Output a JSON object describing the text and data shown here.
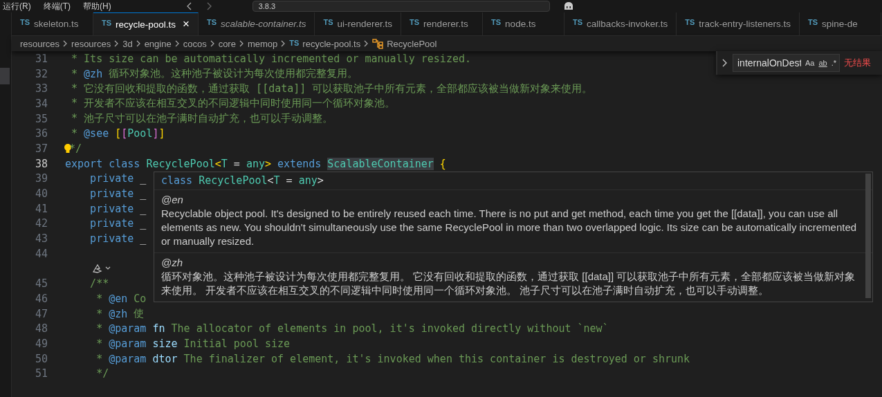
{
  "menu": [
    "运行(R)",
    "终端(T)",
    "帮助(H)"
  ],
  "command_center": {
    "value": "3.8.3"
  },
  "tabs": [
    {
      "lang": "TS",
      "label": "skeleton.ts",
      "selected": false,
      "preview": false
    },
    {
      "lang": "TS",
      "label": "recycle-pool.ts",
      "selected": true,
      "preview": false,
      "close": "×"
    },
    {
      "lang": "TS",
      "label": "scalable-container.ts",
      "selected": false,
      "preview": true
    },
    {
      "lang": "TS",
      "label": "ui-renderer.ts",
      "selected": false,
      "preview": false
    },
    {
      "lang": "TS",
      "label": "renderer.ts",
      "selected": false,
      "preview": false
    },
    {
      "lang": "TS",
      "label": "node.ts",
      "selected": false,
      "preview": false
    },
    {
      "lang": "TS",
      "label": "callbacks-invoker.ts",
      "selected": false,
      "preview": false
    },
    {
      "lang": "TS",
      "label": "track-entry-listeners.ts",
      "selected": false,
      "preview": false
    },
    {
      "lang": "TS",
      "label": "spine-de",
      "selected": false,
      "preview": false
    }
  ],
  "breadcrumb": [
    {
      "kind": "folder",
      "label": "resources"
    },
    {
      "kind": "folder",
      "label": "resources"
    },
    {
      "kind": "folder",
      "label": "3d"
    },
    {
      "kind": "folder",
      "label": "engine"
    },
    {
      "kind": "folder",
      "label": "cocos"
    },
    {
      "kind": "folder",
      "label": "core"
    },
    {
      "kind": "folder",
      "label": "memop"
    },
    {
      "kind": "file",
      "lang": "TS",
      "label": "recycle-pool.ts"
    },
    {
      "kind": "class",
      "label": "RecyclePool"
    }
  ],
  "find_widget": {
    "value": "internalOnDest",
    "options": [
      "Aa",
      "ab",
      ".*"
    ],
    "result": "无结果"
  },
  "lines": [
    {
      "number": "31",
      "current": false,
      "tokens": [
        {
          "kind": "comment",
          "s": " * Its size can be automatically incremented or manually resized."
        }
      ]
    },
    {
      "number": "32",
      "current": false,
      "tokens": [
        {
          "kind": "comment",
          "s": " * "
        },
        {
          "kind": "tag",
          "s": "@zh"
        },
        {
          "kind": "comment",
          "s": " 循环对象池。这种池子被设计为每次使用都完整复用。"
        }
      ]
    },
    {
      "number": "33",
      "current": false,
      "tokens": [
        {
          "kind": "comment",
          "s": " * 它没有回收和提取的函数，通过获取 [[data]] 可以获取池子中所有元素，全部都应该被当做新对象来使用。"
        }
      ]
    },
    {
      "number": "34",
      "current": false,
      "tokens": [
        {
          "kind": "comment",
          "s": " * 开发者不应该在相互交叉的不同逻辑中同时使用同一个循环对象池。"
        }
      ]
    },
    {
      "number": "35",
      "current": false,
      "tokens": [
        {
          "kind": "comment",
          "s": " * 池子尺寸可以在池子满时自动扩充，也可以手动调整。"
        }
      ]
    },
    {
      "number": "36",
      "current": false,
      "tokens": [
        {
          "kind": "comment",
          "s": " * "
        },
        {
          "kind": "tag",
          "s": "@see "
        },
        {
          "kind": "bracket1",
          "s": "["
        },
        {
          "kind": "bracket2",
          "s": "["
        },
        {
          "kind": "type",
          "s": "Pool"
        },
        {
          "kind": "bracket2",
          "s": "]"
        },
        {
          "kind": "bracket1",
          "s": "]"
        }
      ]
    },
    {
      "number": "37",
      "current": false,
      "bulb": true,
      "tokens": [
        {
          "kind": "comment",
          "s": "*/"
        }
      ]
    },
    {
      "number": "38",
      "current": true,
      "tokens": [
        {
          "kind": "keyword",
          "s": "export class "
        },
        {
          "kind": "type",
          "s": "RecyclePool"
        },
        {
          "kind": "bracket1",
          "s": "<"
        },
        {
          "kind": "type",
          "s": "T"
        },
        {
          "kind": "plain",
          "s": " = "
        },
        {
          "kind": "type",
          "s": "any"
        },
        {
          "kind": "bracket1",
          "s": ">"
        },
        {
          "kind": "keyword",
          "s": " extends "
        },
        {
          "kind": "highlight",
          "s": "ScalableContainer"
        },
        {
          "kind": "bracket1",
          "s": " {"
        }
      ]
    },
    {
      "number": "39",
      "current": false,
      "tokens": [
        {
          "kind": "keyword",
          "s": "    private"
        },
        {
          "kind": "plain",
          "s": " _"
        }
      ]
    },
    {
      "number": "40",
      "current": false,
      "tokens": [
        {
          "kind": "keyword",
          "s": "    private"
        },
        {
          "kind": "plain",
          "s": " _"
        }
      ]
    },
    {
      "number": "41",
      "current": false,
      "tokens": [
        {
          "kind": "keyword",
          "s": "    private"
        },
        {
          "kind": "plain",
          "s": " _"
        }
      ]
    },
    {
      "number": "42",
      "current": false,
      "tokens": [
        {
          "kind": "keyword",
          "s": "    private"
        },
        {
          "kind": "plain",
          "s": " _"
        }
      ]
    },
    {
      "number": "43",
      "current": false,
      "tokens": [
        {
          "kind": "keyword",
          "s": "    private"
        },
        {
          "kind": "plain",
          "s": " _"
        }
      ]
    },
    {
      "number": "44",
      "current": false
    },
    {
      "kind": "codelens"
    },
    {
      "number": "45",
      "current": false,
      "tokens": [
        {
          "kind": "comment",
          "s": "    /**"
        }
      ]
    },
    {
      "number": "46",
      "current": false,
      "tokens": [
        {
          "kind": "comment",
          "s": "     * "
        },
        {
          "kind": "tag",
          "s": "@en"
        },
        {
          "kind": "comment",
          "s": " Co"
        }
      ]
    },
    {
      "number": "47",
      "current": false,
      "tokens": [
        {
          "kind": "comment",
          "s": "     * "
        },
        {
          "kind": "tag",
          "s": "@zh"
        },
        {
          "kind": "comment",
          "s": " 使"
        }
      ]
    },
    {
      "number": "48",
      "current": false,
      "tokens": [
        {
          "kind": "comment",
          "s": "     * "
        },
        {
          "kind": "tag",
          "s": "@param"
        },
        {
          "kind": "param",
          "s": " fn"
        },
        {
          "kind": "comment",
          "s": " The allocator of elements in pool, it's invoked directly without `new`"
        }
      ]
    },
    {
      "number": "49",
      "current": false,
      "tokens": [
        {
          "kind": "comment",
          "s": "     * "
        },
        {
          "kind": "tag",
          "s": "@param"
        },
        {
          "kind": "param",
          "s": " size"
        },
        {
          "kind": "comment",
          "s": " Initial pool size"
        }
      ]
    },
    {
      "number": "50",
      "current": false,
      "tokens": [
        {
          "kind": "comment",
          "s": "     * "
        },
        {
          "kind": "tag",
          "s": "@param"
        },
        {
          "kind": "param",
          "s": " dtor"
        },
        {
          "kind": "comment",
          "s": " The finalizer of element, it's invoked when this container is destroyed or shrunk"
        }
      ]
    },
    {
      "number": "51",
      "current": false,
      "tokens": [
        {
          "kind": "comment",
          "s": "     */"
        }
      ]
    }
  ],
  "hover": {
    "signature": [
      {
        "kind": "keyword",
        "s": "class "
      },
      {
        "kind": "type",
        "s": "RecyclePool"
      },
      {
        "kind": "plain",
        "s": "<"
      },
      {
        "kind": "type",
        "s": "T"
      },
      {
        "kind": "plain",
        "s": " = "
      },
      {
        "kind": "type",
        "s": "any"
      },
      {
        "kind": "plain",
        "s": ">"
      }
    ],
    "sections": [
      {
        "tag": "@en",
        "text": "Recyclable object pool. It's designed to be entirely reused each time. There is no put and get method, each time you get the [[data]], you can use all elements as new. You shouldn't simultaneously use the same RecyclePool in more than two overlapped logic. Its size can be automatically incremented or manually resized."
      },
      {
        "tag": "@zh",
        "text": "循环对象池。这种池子被设计为每次使用都完整复用。 它没有回收和提取的函数，通过获取 [[data]] 可以获取池子中所有元素，全部都应该被当做新对象来使用。 开发者不应该在相互交叉的不同逻辑中同时使用同一个循环对象池。 池子尺寸可以在池子满时自动扩充，也可以手动调整。"
      }
    ]
  }
}
